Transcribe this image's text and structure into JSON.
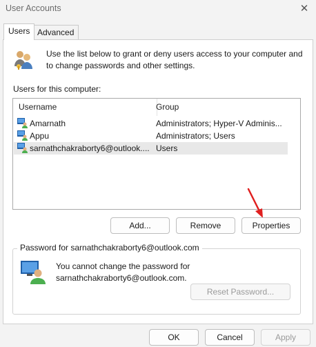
{
  "window": {
    "title": "User Accounts",
    "close_glyph": "✕"
  },
  "tabs": [
    {
      "label": "Users"
    },
    {
      "label": "Advanced"
    }
  ],
  "intro_text": "Use the list below to grant or deny users access to your computer and to change passwords and other settings.",
  "users_label": "Users for this computer:",
  "table": {
    "columns": [
      "Username",
      "Group"
    ],
    "rows": [
      {
        "username": "Amarnath",
        "group": "Administrators; Hyper-V Adminis..."
      },
      {
        "username": "Appu",
        "group": "Administrators; Users"
      },
      {
        "username": "sarnathchakraborty6@outlook....",
        "group": "Users"
      }
    ],
    "selected_index": 2
  },
  "list_buttons": {
    "add": "Add...",
    "remove": "Remove",
    "properties": "Properties"
  },
  "password_group": {
    "legend": "Password for sarnathchakraborty6@outlook.com",
    "line1": "You cannot change the password for",
    "line2": "sarnathchakraborty6@outlook.com.",
    "reset_button": "Reset Password..."
  },
  "footer_buttons": {
    "ok": "OK",
    "cancel": "Cancel",
    "apply": "Apply"
  },
  "colors": {
    "arrow": "#e02020",
    "selection": "#e8e8e8",
    "icon_blue": "#1f5fa8",
    "icon_green": "#4caf50"
  }
}
